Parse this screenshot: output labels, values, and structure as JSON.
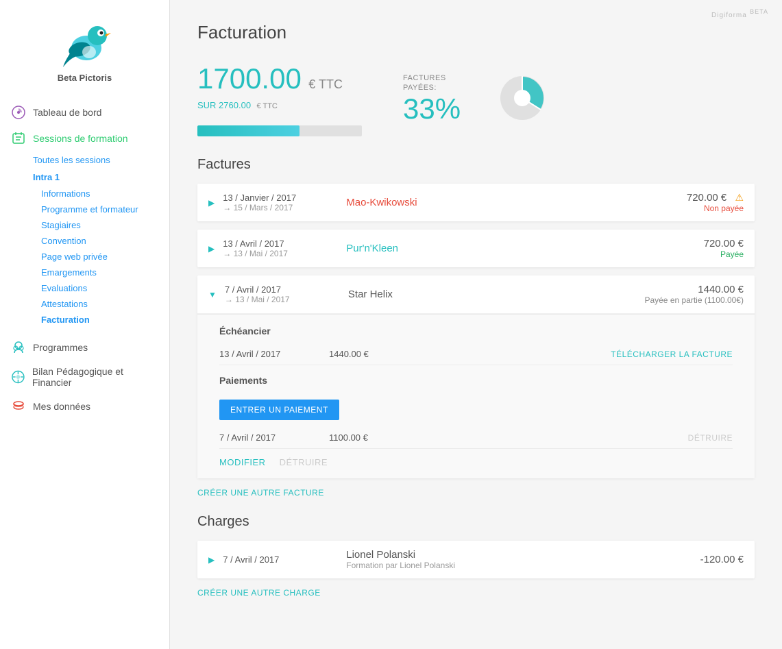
{
  "app": {
    "name": "Beta Pictoris",
    "badge": "Digiforma",
    "badge_sub": "BETA"
  },
  "sidebar": {
    "nav_items": [
      {
        "id": "tableau",
        "label": "Tableau de bord",
        "icon": "dashboard"
      },
      {
        "id": "sessions",
        "label": "Sessions de formation",
        "icon": "sessions",
        "active": true
      }
    ],
    "sub_sessions": [
      {
        "id": "toutes",
        "label": "Toutes les sessions"
      },
      {
        "id": "intra1",
        "label": "Intra 1",
        "bold": true
      }
    ],
    "sub_intra": [
      {
        "id": "informations",
        "label": "Informations"
      },
      {
        "id": "programme",
        "label": "Programme et formateur"
      },
      {
        "id": "stagiaires",
        "label": "Stagiaires"
      },
      {
        "id": "convention",
        "label": "Convention"
      },
      {
        "id": "pageweb",
        "label": "Page web privée"
      },
      {
        "id": "emargements",
        "label": "Emargements"
      },
      {
        "id": "evaluations",
        "label": "Evaluations"
      },
      {
        "id": "attestations",
        "label": "Attestations"
      },
      {
        "id": "facturation",
        "label": "Facturation",
        "current": true
      }
    ],
    "main_items": [
      {
        "id": "programmes",
        "label": "Programmes",
        "icon": "programmes"
      },
      {
        "id": "bilan",
        "label": "Bilan Pédagogique et Financier",
        "icon": "bilan"
      },
      {
        "id": "mesdonnees",
        "label": "Mes données",
        "icon": "mesdonnees"
      }
    ]
  },
  "page": {
    "title": "Facturation",
    "stats": {
      "paid_amount": "1700.00",
      "currency": "€ TTC",
      "total_label": "SUR 2760.00",
      "total_currency": "€ TTC",
      "percent_label": "FACTURES\nPAYÉES:",
      "percent_value": "33%",
      "progress_percent": 62
    },
    "factures_section_title": "Factures",
    "invoices": [
      {
        "id": "inv1",
        "date_main": "13 / Janvier / 2017",
        "date_sub": "→ 15 / Mars / 2017",
        "client": "Mao-Kwikowski",
        "client_color": "red",
        "amount": "720.00 €",
        "status": "Non payée",
        "status_color": "red",
        "warning": true,
        "expanded": false
      },
      {
        "id": "inv2",
        "date_main": "13 / Avril / 2017",
        "date_sub": "→ 13 / Mai / 2017",
        "client": "Pur'n'Kleen",
        "client_color": "teal",
        "amount": "720.00 €",
        "status": "Payée",
        "status_color": "green",
        "warning": false,
        "expanded": false
      },
      {
        "id": "inv3",
        "date_main": "7 / Avril / 2017",
        "date_sub": "→ 13 / Mai / 2017",
        "client": "Star Helix",
        "client_color": "dark",
        "amount": "1440.00 €",
        "status": "Payée en partie (1100.00€)",
        "status_color": "grey",
        "warning": false,
        "expanded": true,
        "echeancier": {
          "title": "Échéancier",
          "rows": [
            {
              "date": "13 / Avril / 2017",
              "amount": "1440.00 €",
              "action": "TÉLÉCHARGER LA FACTURE"
            }
          ]
        },
        "paiements": {
          "title": "Paiements",
          "btn_label": "ENTRER UN PAIEMENT",
          "rows": [
            {
              "date": "7 / Avril / 2017",
              "amount": "1100.00 €",
              "action": "DÉTRUIRE"
            }
          ]
        },
        "footer_actions": [
          {
            "label": "MODIFIER",
            "disabled": false
          },
          {
            "label": "DÉTRUIRE",
            "disabled": true
          }
        ]
      }
    ],
    "create_invoice_label": "CRÉER UNE AUTRE FACTURE",
    "charges_section_title": "Charges",
    "charges": [
      {
        "id": "charge1",
        "date": "7 / Avril / 2017",
        "name": "Lionel Polanski",
        "sub": "Formation par Lionel Polanski",
        "amount": "-120.00 €"
      }
    ],
    "create_charge_label": "CRÉER UNE AUTRE CHARGE"
  }
}
